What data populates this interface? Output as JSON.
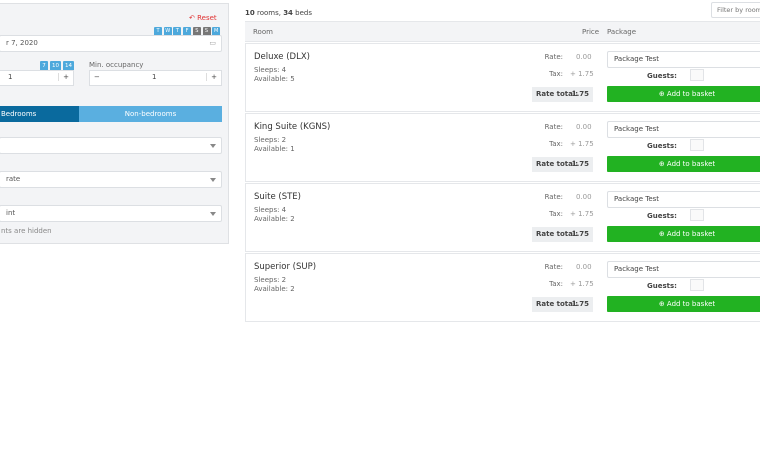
{
  "left": {
    "reset": "Reset",
    "days": [
      "T",
      "W",
      "T",
      "F",
      "S",
      "S",
      "M"
    ],
    "date": "r 7, 2020",
    "nights_presets": [
      "7",
      "10",
      "14"
    ],
    "nights_value": "1",
    "min_occupancy_label": "Min. occupancy",
    "min_occupancy_value": "1",
    "tabs": [
      "Bedrooms",
      "Non-bedrooms"
    ],
    "select1": "",
    "select2": "rate",
    "select3": "int",
    "hint": "nts are hidden"
  },
  "summary": {
    "rooms": "10",
    "rooms_text": " rooms, ",
    "beds": "34",
    "beds_text": " beds"
  },
  "filter_placeholder": "Filter by room",
  "table": {
    "headers": {
      "room": "Room",
      "price": "Price",
      "package": "Package"
    },
    "rate_label": "Rate:",
    "tax_label": "Tax:",
    "total_label": "Rate total:",
    "guests_label": "Guests:",
    "add_label": "Add to basket",
    "rows": [
      {
        "name": "Deluxe (DLX)",
        "sleeps": "Sleeps: 4",
        "available": "Available: 5",
        "rate": "0.00",
        "tax": "+ 1.75",
        "total": "1.75",
        "package": "Package Test"
      },
      {
        "name": "King Suite (KGNS)",
        "sleeps": "Sleeps: 2",
        "available": "Available: 1",
        "rate": "0.00",
        "tax": "+ 1.75",
        "total": "1.75",
        "package": "Package Test"
      },
      {
        "name": "Suite (STE)",
        "sleeps": "Sleeps: 4",
        "available": "Available: 2",
        "rate": "0.00",
        "tax": "+ 1.75",
        "total": "1.75",
        "package": "Package Test"
      },
      {
        "name": "Superior (SUP)",
        "sleeps": "Sleeps: 2",
        "available": "Available: 2",
        "rate": "0.00",
        "tax": "+ 1.75",
        "total": "1.75",
        "package": "Package Test"
      }
    ]
  },
  "colors": {
    "active_tab": "#0a6a9e",
    "inactive_tab": "#5aafe0",
    "add_button": "#22b222",
    "reset": "#e03030"
  }
}
